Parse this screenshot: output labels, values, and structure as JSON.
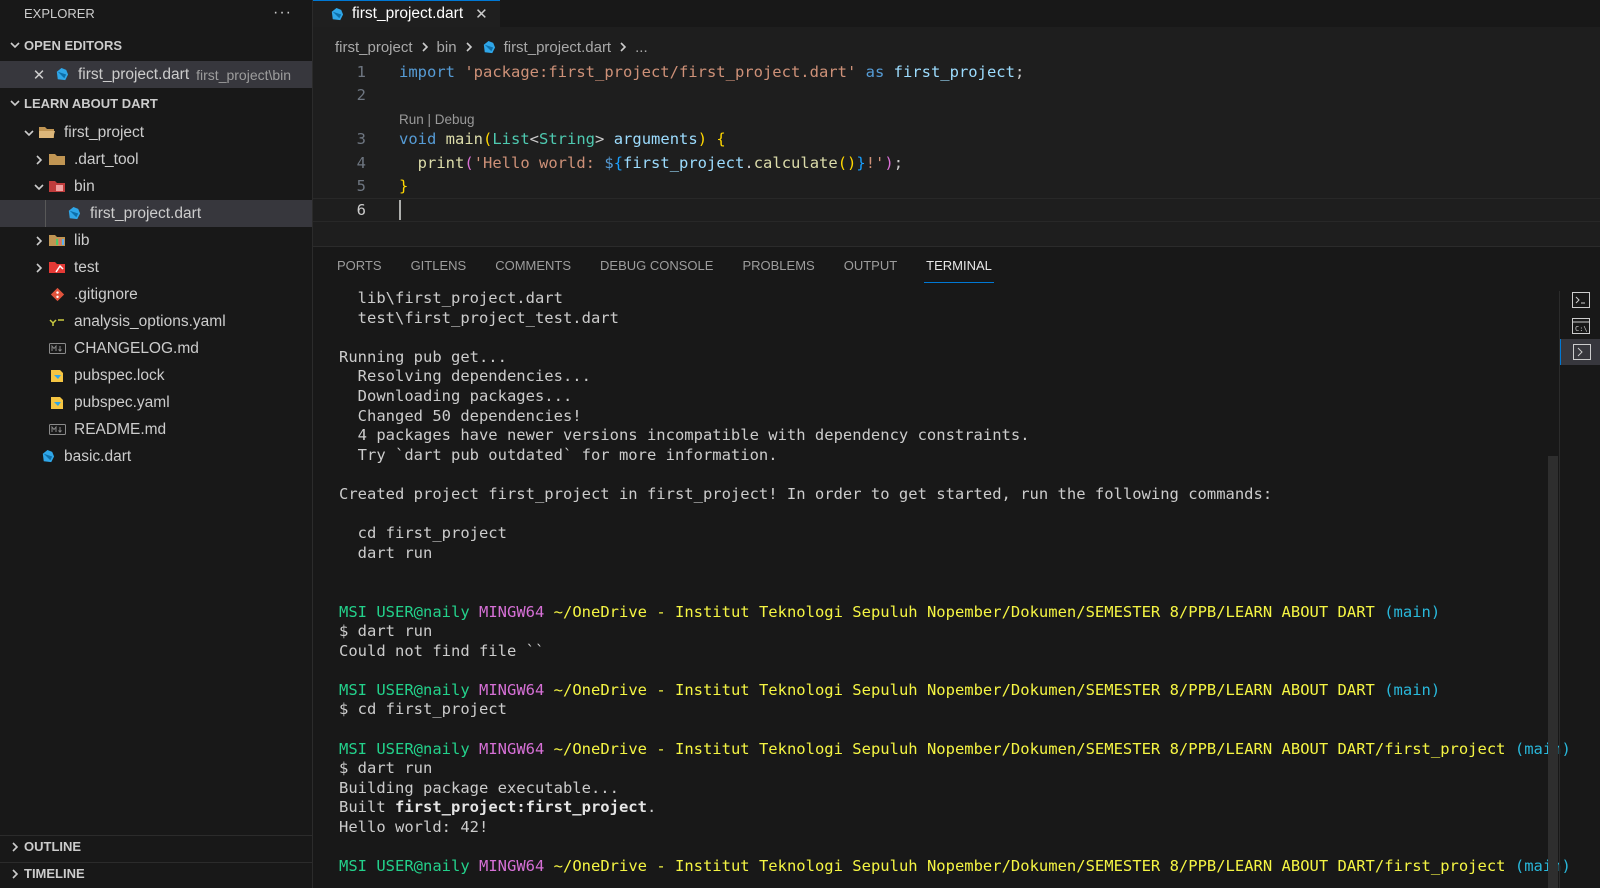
{
  "explorer": {
    "title": "EXPLORER",
    "more": "···"
  },
  "open_editors": {
    "title": "OPEN EDITORS",
    "items": [
      {
        "name": "first_project.dart",
        "desc": "first_project\\bin"
      }
    ]
  },
  "workspace": {
    "title": "LEARN ABOUT DART",
    "tree": [
      {
        "label": "first_project"
      },
      {
        "label": ".dart_tool"
      },
      {
        "label": "bin"
      },
      {
        "label": "first_project.dart"
      },
      {
        "label": "lib"
      },
      {
        "label": "test"
      },
      {
        "label": ".gitignore"
      },
      {
        "label": "analysis_options.yaml"
      },
      {
        "label": "CHANGELOG.md"
      },
      {
        "label": "pubspec.lock"
      },
      {
        "label": "pubspec.yaml"
      },
      {
        "label": "README.md"
      },
      {
        "label": "basic.dart"
      }
    ]
  },
  "outline": {
    "title": "OUTLINE"
  },
  "timeline": {
    "title": "TIMELINE"
  },
  "editor": {
    "tab": {
      "label": "first_project.dart",
      "close": "✕"
    },
    "breadcrumbs": [
      "first_project",
      "bin",
      "first_project.dart",
      "..."
    ],
    "codelens": "Run | Debug",
    "line_numbers": [
      "1",
      "2",
      "3",
      "4",
      "5",
      "6"
    ],
    "code": {
      "l1": {
        "kw": "import",
        "str": "'package:first_project/first_project.dart'",
        "as": "as",
        "alias": "first_project",
        "semi": ";"
      },
      "l3": {
        "kw": "void",
        "fn": "main",
        "type1": "List",
        "type2": "String",
        "param": "arguments"
      },
      "l4": {
        "fn": "print",
        "str1": "'Hello world: ",
        "interp": "first_project",
        "call": "calculate",
        "str2": "!'"
      },
      "l5": {
        "brace": "}"
      }
    }
  },
  "panel": {
    "tabs": [
      "PORTS",
      "GITLENS",
      "COMMENTS",
      "DEBUG CONSOLE",
      "PROBLEMS",
      "OUTPUT",
      "TERMINAL"
    ],
    "active_tab": "TERMINAL"
  },
  "terminal": {
    "lines": [
      "  lib\\first_project.dart",
      "  test\\first_project_test.dart",
      "",
      "Running pub get...",
      "  Resolving dependencies...",
      "  Downloading packages...",
      "  Changed 50 dependencies!",
      "  4 packages have newer versions incompatible with dependency constraints.",
      "  Try `dart pub outdated` for more information.",
      "",
      "Created project first_project in first_project! In order to get started, run the following commands:",
      "",
      "  cd first_project",
      "  dart run",
      "",
      ""
    ],
    "prompt": {
      "user": "MSI USER@naily",
      "shell": "MINGW64",
      "path1": "~/OneDrive - Institut Teknologi Sepuluh Nopember/Dokumen/SEMESTER 8/PPB/LEARN ABOUT DART",
      "path2": "~/OneDrive - Institut Teknologi Sepuluh Nopember/Dokumen/SEMESTER 8/PPB/LEARN ABOUT DART/first_project",
      "branch": "(main)"
    },
    "session": {
      "cmd1": "$ dart run",
      "out1": "Could not find file ``",
      "cmd2": "$ cd first_project",
      "cmd3": "$ dart run",
      "out3a": "Building package executable...",
      "out3b_prefix": "Built ",
      "out3b_bold": "first_project:first_project",
      "out3b_suffix": ".",
      "out3c": "Hello world: 42!"
    }
  },
  "colors": {
    "accent": "#0078d4",
    "dart_blue": "#2fa6e8",
    "folder": "#c09553"
  }
}
